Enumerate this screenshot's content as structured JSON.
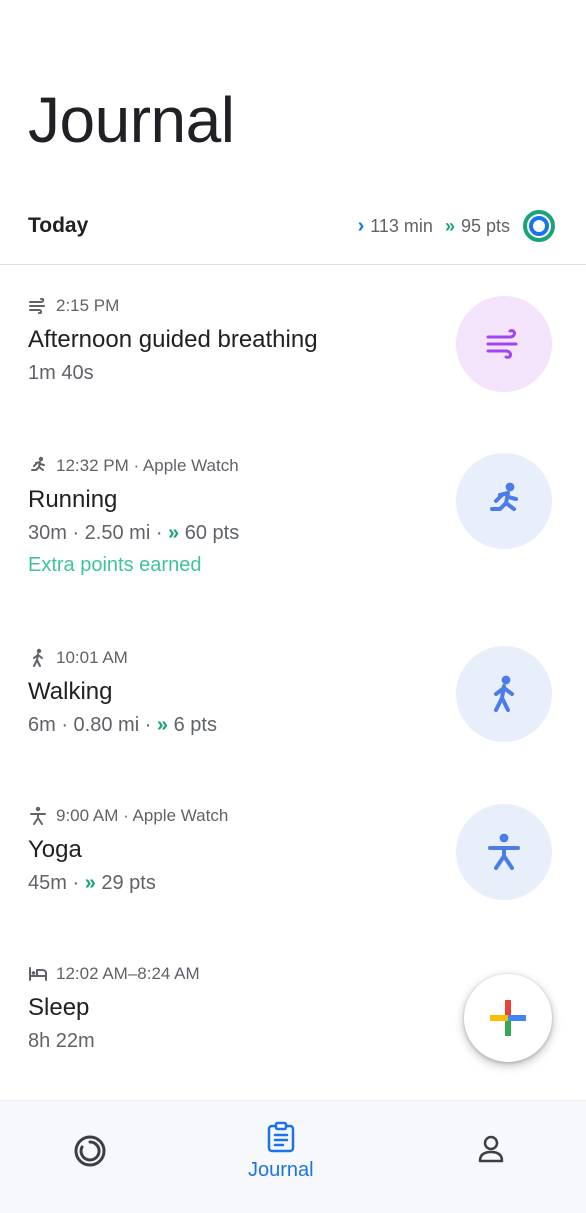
{
  "header": {
    "title": "Journal"
  },
  "today": {
    "label": "Today",
    "move_minutes": "113 min",
    "heart_points": "95 pts"
  },
  "entries": [
    {
      "icon": "breathing-icon",
      "time": "2:15 PM",
      "source": "",
      "name": "Afternoon guided breathing",
      "detail_main": "1m 40s",
      "detail_pts": "",
      "extra": ""
    },
    {
      "icon": "running-icon",
      "time": "12:32 PM · Apple Watch",
      "source": "",
      "name": "Running",
      "detail_main": "30m · 2.50 mi · ",
      "detail_pts": "60 pts",
      "extra": "Extra points earned"
    },
    {
      "icon": "walking-icon",
      "time": "10:01 AM",
      "source": "",
      "name": "Walking",
      "detail_main": "6m · 0.80 mi · ",
      "detail_pts": "6 pts",
      "extra": ""
    },
    {
      "icon": "yoga-icon",
      "time": "9:00 AM · Apple Watch",
      "source": "",
      "name": "Yoga",
      "detail_main": "45m · ",
      "detail_pts": "29 pts",
      "extra": ""
    },
    {
      "icon": "bed-icon",
      "time": "12:02 AM–8:24 AM",
      "source": "",
      "name": "Sleep",
      "detail_main": "8h 22m",
      "detail_pts": "",
      "extra": ""
    }
  ],
  "fab": {
    "icon": "add-icon"
  },
  "bottom_nav": {
    "home_icon": "home-ring-icon",
    "journal_label": "Journal",
    "profile_icon": "profile-icon"
  },
  "colors": {
    "accent_blue": "#1a73e8",
    "heart_teal": "#1aa37a",
    "extra_green": "#3fc49a",
    "breathing_bg": "#f3e4fb",
    "activity_bg": "#e9eefb"
  }
}
